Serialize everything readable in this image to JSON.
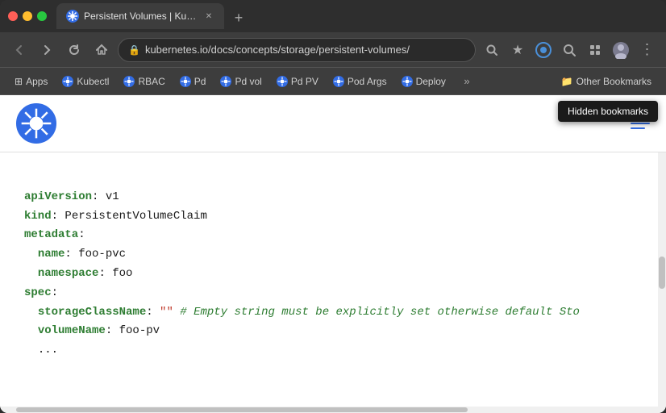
{
  "browser": {
    "tab": {
      "title": "Persistent Volumes | Kubernete…",
      "favicon_label": "K8s"
    },
    "new_tab_icon": "+",
    "nav": {
      "back_label": "‹",
      "forward_label": "›",
      "refresh_label": "↻",
      "home_label": "⌂",
      "address": "kubernetes.io/docs/concepts/storage/persistent-volumes/",
      "search_icon": "🔍",
      "bookmark_icon": "★",
      "profile_icon": "👤",
      "extensions_icon": "🧩",
      "menu_icon": "⋮"
    },
    "bookmarks": [
      {
        "label": "Apps",
        "icon": "⊞"
      },
      {
        "label": "Kubectl",
        "icon": "K"
      },
      {
        "label": "RBAC",
        "icon": "K"
      },
      {
        "label": "Pd",
        "icon": "K"
      },
      {
        "label": "Pd vol",
        "icon": "K"
      },
      {
        "label": "Pd PV",
        "icon": "K"
      },
      {
        "label": "Pod Args",
        "icon": "K"
      },
      {
        "label": "Deploy",
        "icon": "K"
      }
    ],
    "hidden_bookmarks": {
      "button_label": "Other Bookmarks",
      "tooltip": "Hidden bookmarks",
      "folder_icon": "📁"
    }
  },
  "page": {
    "code": {
      "lines": [
        {
          "key": "apiVersion",
          "value": " v1"
        },
        {
          "key": "kind",
          "value": " PersistentVolumeClaim"
        },
        {
          "key": "metadata",
          "value": ":"
        },
        {
          "indent": true,
          "key": "name",
          "value": " foo-pvc"
        },
        {
          "indent": true,
          "key": "namespace",
          "value": " foo"
        },
        {
          "key": "spec",
          "value": ":"
        },
        {
          "indent": true,
          "key": "storageClassName",
          "value": " \"\" # Empty string must be explicitly set otherwise default Sto"
        },
        {
          "indent": true,
          "key": "volumeName",
          "value": " foo-pv"
        },
        {
          "dots": true
        }
      ]
    }
  }
}
